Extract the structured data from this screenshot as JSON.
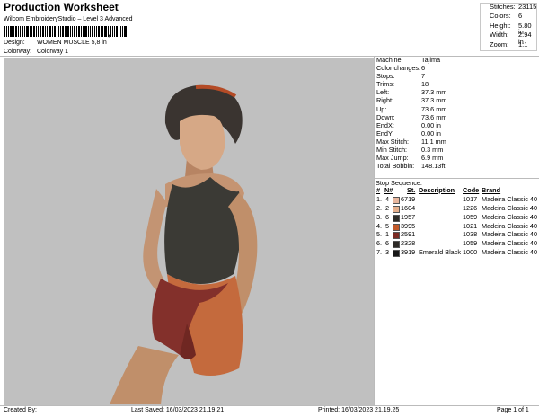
{
  "header": {
    "title": "Production Worksheet",
    "subtitle": "Wilcom EmbroideryStudio – Level 3 Advanced",
    "barcode_mark": ","
  },
  "design": {
    "design_label": "Design:",
    "design_value": "WOMEN MUSCLE 5,8 in",
    "colorway_label": "Colorway:",
    "colorway_value": "Colorway 1"
  },
  "stats": [
    {
      "label": "Stitches:",
      "value": "23115"
    },
    {
      "label": "Colors:",
      "value": "6"
    },
    {
      "label": "Height:",
      "value": "5.80 in"
    },
    {
      "label": "Width:",
      "value": "2.94 in"
    },
    {
      "label": "Zoom:",
      "value": "1:1"
    }
  ],
  "machine_info": [
    {
      "label": "Machine:",
      "value": "Tajima"
    },
    {
      "label": "Color changes:",
      "value": "6"
    },
    {
      "label": "Stops:",
      "value": "7"
    },
    {
      "label": "Trims:",
      "value": "18"
    },
    {
      "label": "Left:",
      "value": "37.3 mm"
    },
    {
      "label": "Right:",
      "value": "37.3 mm"
    },
    {
      "label": "Up:",
      "value": "73.6 mm"
    },
    {
      "label": "Down:",
      "value": "73.6 mm"
    },
    {
      "label": "EndX:",
      "value": "0.00 in"
    },
    {
      "label": "EndY:",
      "value": "0.00 in"
    },
    {
      "label": "Max Stitch:",
      "value": "11.1 mm"
    },
    {
      "label": "Min Stitch:",
      "value": "0.3 mm"
    },
    {
      "label": "Max Jump:",
      "value": "6.9 mm"
    },
    {
      "label": "Total Bobbin:",
      "value": "148.13ft"
    }
  ],
  "stop_sequence": {
    "title": "Stop Sequence:",
    "headers": {
      "stop": "#",
      "num": "N#",
      "st": "St.",
      "description": "Description",
      "code": "Code",
      "brand": "Brand"
    },
    "rows": [
      {
        "stop": "1.",
        "num": "4",
        "st": "6719",
        "description": "",
        "code": "1017",
        "brand": "Madeira Classic 40",
        "color": "#e8b79e"
      },
      {
        "stop": "2.",
        "num": "2",
        "st": "1604",
        "description": "",
        "code": "1226",
        "brand": "Madeira Classic 40",
        "color": "#e6b08d"
      },
      {
        "stop": "3.",
        "num": "6",
        "st": "1957",
        "description": "",
        "code": "1059",
        "brand": "Madeira Classic 40",
        "color": "#2e2b27"
      },
      {
        "stop": "4.",
        "num": "5",
        "st": "3995",
        "description": "",
        "code": "1021",
        "brand": "Madeira Classic 40",
        "color": "#c25a2a"
      },
      {
        "stop": "5.",
        "num": "1",
        "st": "2591",
        "description": "",
        "code": "1038",
        "brand": "Madeira Classic 40",
        "color": "#7a2a23"
      },
      {
        "stop": "6.",
        "num": "6",
        "st": "2328",
        "description": "",
        "code": "1059",
        "brand": "Madeira Classic 40",
        "color": "#2e2b27"
      },
      {
        "stop": "7.",
        "num": "3",
        "st": "3919",
        "description": "Emerald Black",
        "code": "1000",
        "brand": "Madeira Classic 40",
        "color": "#161616"
      }
    ]
  },
  "footer": {
    "created_by": "Created By:",
    "last_saved": "Last Saved: 16/03/2023 21.19.21",
    "printed": "Printed: 16/03/2023 21.19.25",
    "page": "Page 1 of 1"
  }
}
